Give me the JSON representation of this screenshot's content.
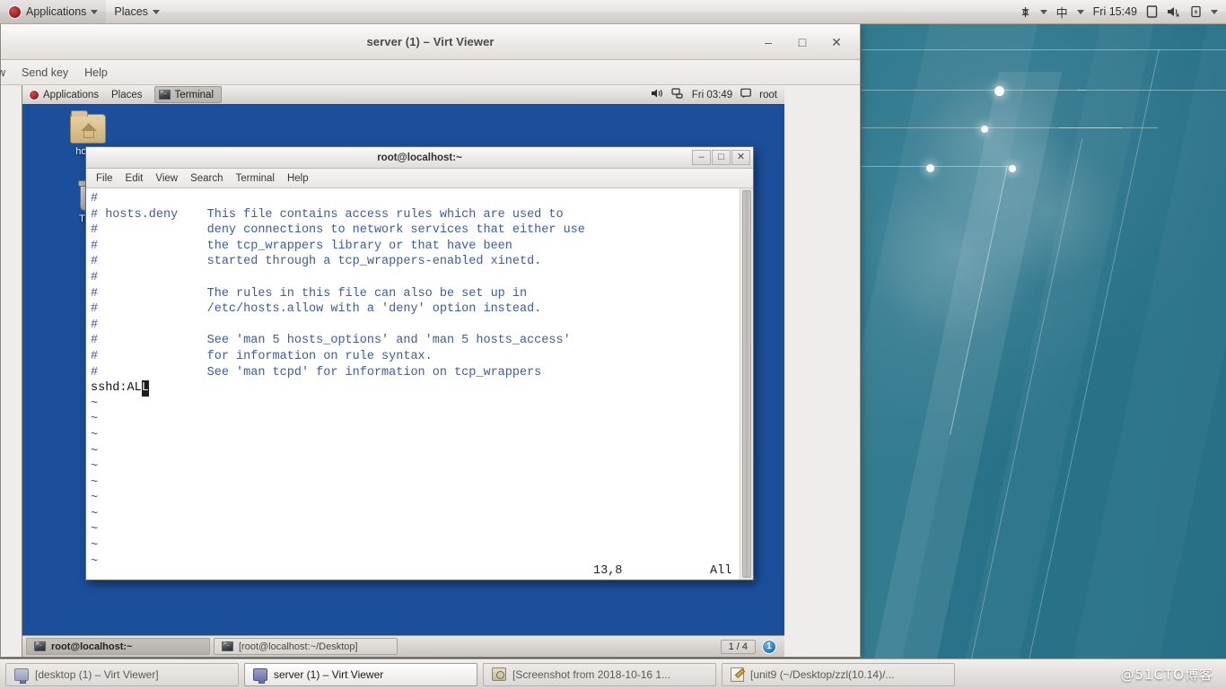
{
  "outer_desktop": {
    "top_panel": {
      "applications_label": "Applications",
      "places_label": "Places",
      "ime_label": "中",
      "clock": "Fri 15:49",
      "icons": [
        "logo-icon",
        "caret-down-icon",
        "network-icon",
        "display-icon",
        "volume-muted-icon",
        "battery-charging-icon",
        "caret-down-icon"
      ]
    },
    "bottom_panel": {
      "tasks": [
        {
          "label": "[desktop (1) – Virt Viewer]",
          "icon": "monitor-icon",
          "active": false
        },
        {
          "label": "server (1) – Virt Viewer",
          "icon": "monitor-icon",
          "active": true
        },
        {
          "label": "[Screenshot from 2018-10-16 1...",
          "icon": "screenshot-icon",
          "active": false
        },
        {
          "label": "[unit9 (~/Desktop/zzl(10.14)/...",
          "icon": "text-editor-icon",
          "active": false
        }
      ],
      "watermark": "@51CTO博客"
    }
  },
  "virt_viewer": {
    "title": "server (1) – Virt Viewer",
    "window_buttons": {
      "minimize": "–",
      "maximize": "□",
      "close": "✕"
    },
    "menu": [
      "w",
      "Send key",
      "Help"
    ]
  },
  "vm_guest": {
    "top_panel": {
      "applications_label": "Applications",
      "places_label": "Places",
      "window_button_label": "Terminal",
      "volume_icon": "volume-icon",
      "network_icon": "network-icon",
      "clock": "Fri 03:49",
      "user_label": "root"
    },
    "desktop_icons": [
      {
        "label": "home",
        "icon": "home-folder-icon"
      },
      {
        "label": "Trash",
        "icon": "trash-icon"
      }
    ],
    "bottom_panel": {
      "tasks": [
        {
          "label": "root@localhost:~",
          "active": true
        },
        {
          "label": "[root@localhost:~/Desktop]",
          "active": false
        }
      ],
      "workspace": "1 / 4",
      "notification_count": "1"
    }
  },
  "terminal": {
    "title": "root@localhost:~",
    "window_buttons": {
      "minimize": "–",
      "maximize": "□",
      "close": "✕"
    },
    "menu": [
      "File",
      "Edit",
      "View",
      "Search",
      "Terminal",
      "Help"
    ],
    "content_lines": [
      {
        "type": "comment",
        "text": "#"
      },
      {
        "type": "comment",
        "text": "# hosts.deny    This file contains access rules which are used to"
      },
      {
        "type": "comment",
        "text": "#               deny connections to network services that either use"
      },
      {
        "type": "comment",
        "text": "#               the tcp_wrappers library or that have been"
      },
      {
        "type": "comment",
        "text": "#               started through a tcp_wrappers-enabled xinetd."
      },
      {
        "type": "comment",
        "text": "#"
      },
      {
        "type": "comment",
        "text": "#               The rules in this file can also be set up in"
      },
      {
        "type": "comment",
        "text": "#               /etc/hosts.allow with a 'deny' option instead."
      },
      {
        "type": "comment",
        "text": "#"
      },
      {
        "type": "comment",
        "text": "#               See 'man 5 hosts_options' and 'man 5 hosts_access'"
      },
      {
        "type": "comment",
        "text": "#               for information on rule syntax."
      },
      {
        "type": "comment",
        "text": "#               See 'man tcpd' for information on tcp_wrappers"
      }
    ],
    "edit_line": {
      "before_cursor": "sshd:AL",
      "cursor_char": "L"
    },
    "tilde_count": 12,
    "status": {
      "position": "13,8",
      "scroll_state": "All"
    }
  }
}
